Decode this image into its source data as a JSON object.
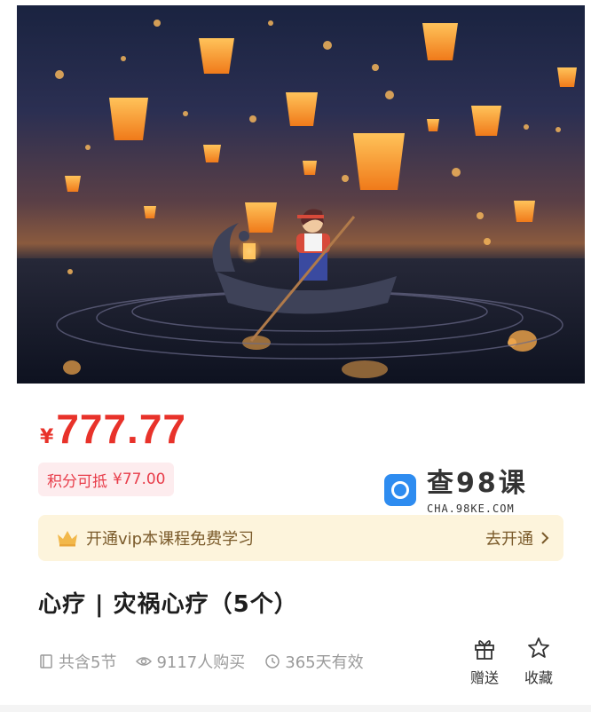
{
  "course": {
    "currency_symbol": "¥",
    "price": "777.77",
    "points_label": "积分可抵",
    "points_value": "¥77.00",
    "title": "心疗 | 灾祸心疗（5个）"
  },
  "vip": {
    "text": "开通vip本课程免费学习",
    "action": "去开通"
  },
  "meta": {
    "lessons": "共含5节",
    "buyers": "9117人购买",
    "validity": "365天有效"
  },
  "actions": {
    "gift": "赠送",
    "favorite": "收藏"
  },
  "watermark": {
    "main": "查98课",
    "sub": "CHA.98KE.COM"
  },
  "colors": {
    "price": "#e8322a",
    "vip_banner_bg": "#fdf4dc",
    "points_badge_bg": "#fdecee"
  }
}
